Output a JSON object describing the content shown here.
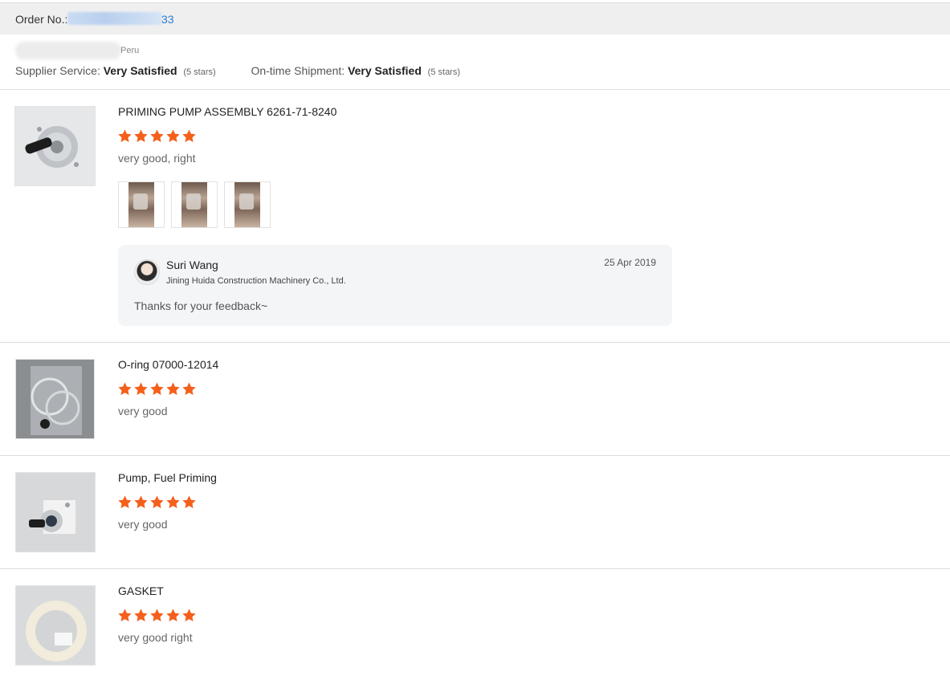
{
  "order": {
    "label": "Order No.:",
    "number_tail": "33"
  },
  "buyer": {
    "country": "Peru"
  },
  "ratings": {
    "supplier_label": "Supplier Service:",
    "supplier_value": "Very Satisfied",
    "supplier_stars": "(5 stars)",
    "shipment_label": "On-time Shipment:",
    "shipment_value": "Very Satisfied",
    "shipment_stars": "(5 stars)"
  },
  "colors": {
    "star": "#f4601b",
    "link": "#2b7bd1"
  },
  "reviews": [
    {
      "title": "PRIMING PUMP ASSEMBLY 6261-71-8240",
      "rating": 5,
      "text": "very good, right",
      "photo_count": 3,
      "reply": {
        "name": "Suri Wang",
        "company": "Jining Huida Construction Machinery Co., Ltd.",
        "date": "25 Apr 2019",
        "text": "Thanks for your feedback~"
      }
    },
    {
      "title": "O-ring 07000-12014",
      "rating": 5,
      "text": "very good"
    },
    {
      "title": "Pump, Fuel Priming",
      "rating": 5,
      "text": "very good"
    },
    {
      "title": "GASKET",
      "rating": 5,
      "text": "very good right"
    }
  ]
}
